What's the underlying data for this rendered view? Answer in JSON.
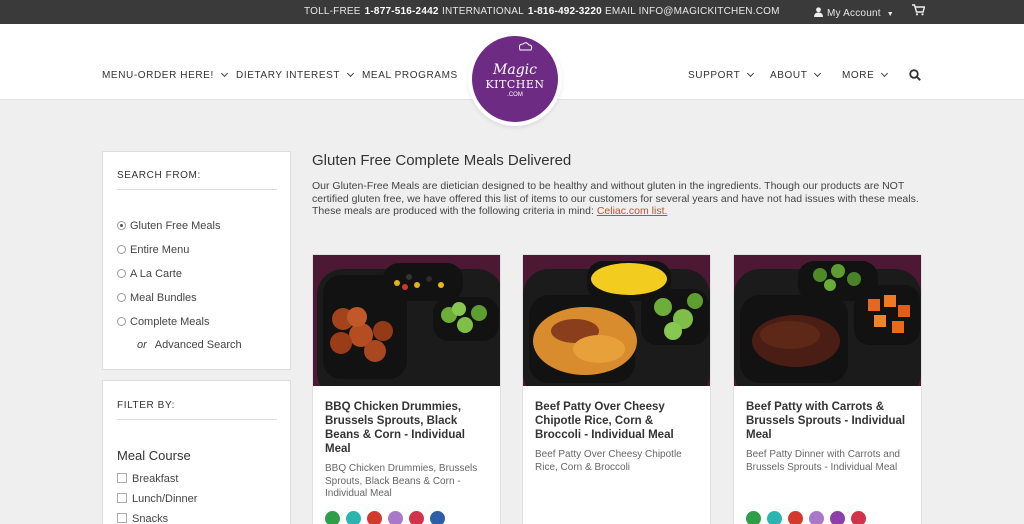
{
  "topbar": {
    "tollfree_label": "TOLL-FREE",
    "tollfree_number": "1-877-516-2442",
    "intl_label": "INTERNATIONAL",
    "intl_number": "1-816-492-3220",
    "email_label": "EMAIL",
    "email_value": "INFO@MAGICKITCHEN.COM",
    "account_label": "My Account",
    "icons": [
      "user-icon",
      "cart-icon"
    ]
  },
  "nav": {
    "menu_order": "MENU-ORDER HERE!",
    "dietary": "DIETARY INTEREST",
    "meal_programs": "MEAL PROGRAMS",
    "support": "SUPPORT",
    "about": "ABOUT",
    "more": "MORE"
  },
  "logo": {
    "line1": "Magic",
    "line2": "KITCHEN",
    "line3": ".COM"
  },
  "search_panel": {
    "title": "SEARCH FROM:",
    "options": [
      "Gluten Free Meals",
      "Entire Menu",
      "A La Carte",
      "Meal Bundles",
      "Complete Meals"
    ],
    "selected": "Gluten Free Meals",
    "or_label": "or",
    "advanced": "Advanced Search"
  },
  "filter_panel": {
    "title": "FILTER BY:",
    "group_title": "Meal Course",
    "options": [
      "Breakfast",
      "Lunch/Dinner",
      "Snacks"
    ]
  },
  "main": {
    "title": "Gluten Free Complete Meals Delivered",
    "intro": "Our Gluten-Free Meals are dietician designed to be healthy and without gluten in the ingredients. Though our products are NOT certified gluten free, we have offered this list of items to our customers for several years and have not had issues with these meals. These meals are produced with the following criteria in mind:",
    "intro_link": "Celiac.com list."
  },
  "products": [
    {
      "title": "BBQ Chicken Drummies, Brussels Sprouts, Black Beans & Corn - Individual Meal",
      "desc": "BBQ Chicken Drummies, Brussels Sprouts, Black Beans & Corn - Individual Meal",
      "badges": [
        "#2e9e4a",
        "#2bb5b0",
        "#d23a2e",
        "#a979c9",
        "#d2334a",
        "#2f5ea8"
      ]
    },
    {
      "title": "Beef Patty Over Cheesy Chipotle Rice, Corn & Broccoli - Individual Meal",
      "desc": "Beef Patty Over Cheesy Chipotle Rice, Corn & Broccoli",
      "badges": []
    },
    {
      "title": "Beef Patty with Carrots & Brussels Sprouts - Individual Meal",
      "desc": "Beef Patty Dinner with Carrots and Brussels Sprouts - Individual Meal",
      "badges": [
        "#2e9e4a",
        "#2bb5b0",
        "#d23a2e",
        "#a979c9",
        "#8c3fa8",
        "#d2334a"
      ]
    }
  ],
  "colors": {
    "brand_purple": "#6d2b84",
    "link": "#c0522a",
    "topbar": "#3a3a3a"
  }
}
